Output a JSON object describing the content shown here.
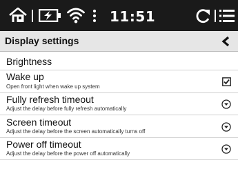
{
  "status_bar": {
    "icons": [
      "home-icon",
      "battery-charging-icon",
      "wifi-icon",
      "menu-dots-icon",
      "refresh-icon",
      "list-menu-icon"
    ],
    "time": "11:51"
  },
  "header": {
    "title": "Display settings",
    "back_icon": "chevron-left-icon"
  },
  "settings": [
    {
      "title": "Brightness",
      "subtitle": "",
      "control": "none"
    },
    {
      "title": "Wake up",
      "subtitle": "Open front light when wake up system",
      "control": "checkbox",
      "checked": true
    },
    {
      "title": "Fully refresh timeout",
      "subtitle": "Adjust the delay before fully refresh automatically",
      "control": "dropdown"
    },
    {
      "title": "Screen timeout",
      "subtitle": "Adjust the delay before the screen automatically turns off",
      "control": "dropdown"
    },
    {
      "title": "Power off timeout",
      "subtitle": "Adjust the delay before the power off automatically",
      "control": "dropdown"
    }
  ],
  "colors": {
    "status_bar_bg": "#1a1a1a",
    "header_bg": "#e6e6e6",
    "text": "#111111"
  }
}
